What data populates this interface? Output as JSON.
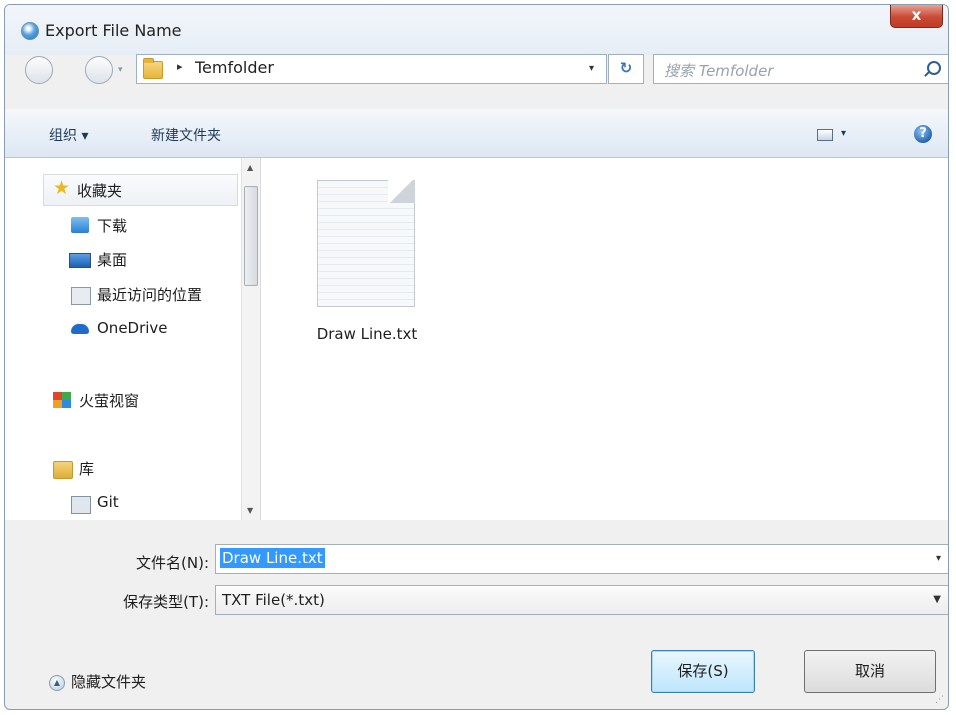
{
  "window": {
    "title": "Export File Name",
    "close_label": "x"
  },
  "address": {
    "separator": "▸",
    "crumb": "Temfolder",
    "dropdown": "▾",
    "refresh": "↻",
    "search_placeholder": "搜索 Temfolder"
  },
  "toolbar": {
    "organize": "组织 ▾",
    "new_folder": "新建文件夹",
    "view_dropdown": "▾",
    "help": "?"
  },
  "sidebar": {
    "items": [
      {
        "label": "收藏夹",
        "icon": "star-icon"
      },
      {
        "label": "下载",
        "icon": "download-folder-icon"
      },
      {
        "label": "桌面",
        "icon": "desktop-icon"
      },
      {
        "label": "最近访问的位置",
        "icon": "recent-places-icon"
      },
      {
        "label": "OneDrive",
        "icon": "onedrive-icon"
      },
      {
        "label": "火萤视窗",
        "icon": "app-tiles-icon"
      },
      {
        "label": "库",
        "icon": "library-icon"
      },
      {
        "label": "Git",
        "icon": "git-icon"
      }
    ]
  },
  "files": [
    {
      "name": "Draw Line.txt",
      "icon": "text-file-icon"
    }
  ],
  "form": {
    "filename_label": "文件名(N):",
    "filename_value": "Draw Line.txt",
    "type_label": "保存类型(T):",
    "type_value": "TXT File(*.txt)"
  },
  "footer": {
    "hide_folders": "隐藏文件夹",
    "save_button": "保存(S)",
    "cancel_button": "取消"
  },
  "colors": {
    "selection": "#3399ff",
    "close_button": "#c94a36",
    "toolbar_text": "#1e395b"
  }
}
